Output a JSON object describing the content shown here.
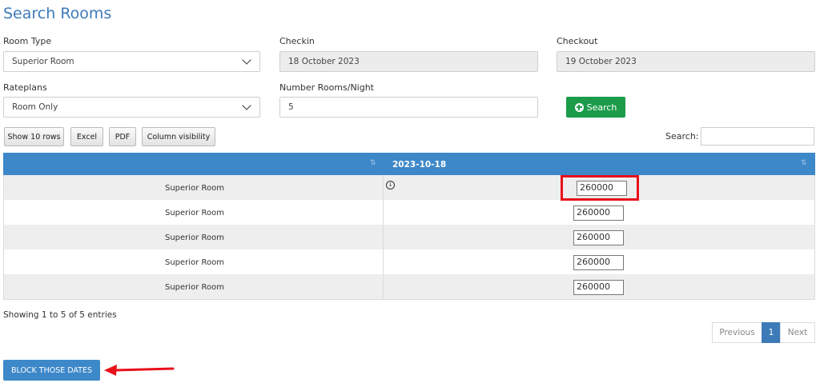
{
  "page": {
    "title": "Search Rooms"
  },
  "form": {
    "room_type": {
      "label": "Room Type",
      "value": "Superior Room"
    },
    "checkin": {
      "label": "Checkin",
      "value": "18 October 2023"
    },
    "checkout": {
      "label": "Checkout",
      "value": "19 October 2023"
    },
    "rateplans": {
      "label": "Rateplans",
      "value": "Room Only"
    },
    "rooms_per_night": {
      "label": "Number Rooms/Night",
      "value": "5"
    },
    "search_button": "Search"
  },
  "toolbar": {
    "buttons": [
      "Show 10 rows",
      "Excel",
      "PDF",
      "Column visibility"
    ],
    "search_label": "Search:",
    "search_value": ""
  },
  "table": {
    "header_date": "2023-10-18",
    "rows": [
      {
        "room": "Superior Room",
        "rate": "260000"
      },
      {
        "room": "Superior Room",
        "rate": "260000"
      },
      {
        "room": "Superior Room",
        "rate": "260000"
      },
      {
        "room": "Superior Room",
        "rate": "260000"
      },
      {
        "room": "Superior Room",
        "rate": "260000"
      }
    ]
  },
  "footer": {
    "info": "Showing 1 to 5 of 5 entries",
    "pagination": {
      "previous": "Previous",
      "page": "1",
      "next": "Next"
    },
    "block_button": "BLOCK THOSE DATES"
  },
  "colors": {
    "accent": "#3d88c9",
    "search_green": "#1c9b4a",
    "annotation_red": "#e8101a"
  }
}
